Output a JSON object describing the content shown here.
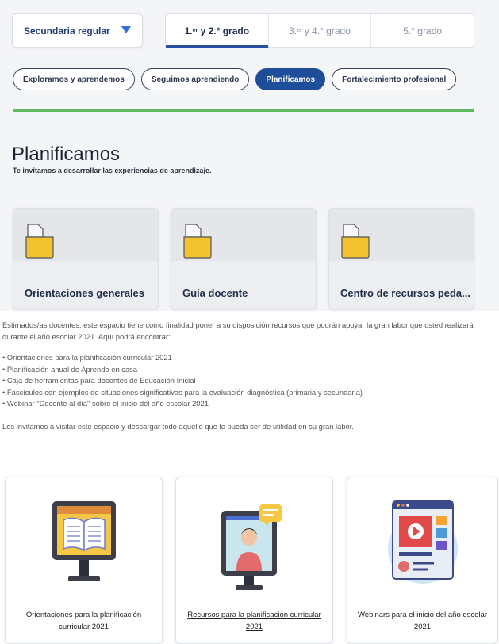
{
  "level_select": {
    "value": "Secundaria regular"
  },
  "grade_tabs": [
    {
      "label_main": "1.",
      "label_sup": "er",
      "label_rest": " y 2.° grado"
    },
    {
      "label_main": "3.",
      "label_sup": "er",
      "label_rest": " y 4.° grado"
    },
    {
      "label_main": "5.° grado",
      "label_sup": "",
      "label_rest": ""
    }
  ],
  "section_tabs": [
    {
      "label": "Exploramos y aprendemos"
    },
    {
      "label": "Seguimos aprendiendo"
    },
    {
      "label": "Planificamos"
    },
    {
      "label": "Fortalecimiento profesional"
    }
  ],
  "section": {
    "title": "Planificamos",
    "subtitle": "Te invitamos a desarrollar las experiencias de aprendizaje."
  },
  "folder_cards": [
    {
      "label": "Orientaciones generales"
    },
    {
      "label": "Guía docente"
    },
    {
      "label": "Centro de recursos peda..."
    }
  ],
  "intro": {
    "paragraph": "Estimados/as docentes, este espacio tiene como finalidad poner a su disposición recursos que podrán apoyar la gran labor que usted realizará durante el año escolar 2021. Aquí podrá encontrar:",
    "bullets": [
      "Orientaciones para la planificación curricular 2021",
      "Planificación anual de Aprendo en casa",
      "Caja de herramientas para docentes de Educación Inicial",
      "Fascículos con ejemplos de situaciones significativas para la evaluación diagnóstica (primaria y secundaria)",
      "Webinar \"Docente al día\" sobre el inicio del año escolar 2021"
    ],
    "closing": "Los invitamos a visitar este espacio y descargar todo aquello que le pueda ser de utilidad en su gran labor."
  },
  "resource_cards": [
    {
      "label": "Orientaciones para la planificación curricular 2021",
      "icon": "book-monitor-icon"
    },
    {
      "label": "Recursos para la planificación curricular 2021",
      "icon": "teacher-monitor-icon"
    },
    {
      "label": "Webinars para el inicio del año escolar 2021",
      "icon": "video-player-icon"
    }
  ],
  "colors": {
    "accent_blue": "#1e4d9a",
    "green_divider": "#5fb85f",
    "folder_yellow": "#f2c230"
  }
}
